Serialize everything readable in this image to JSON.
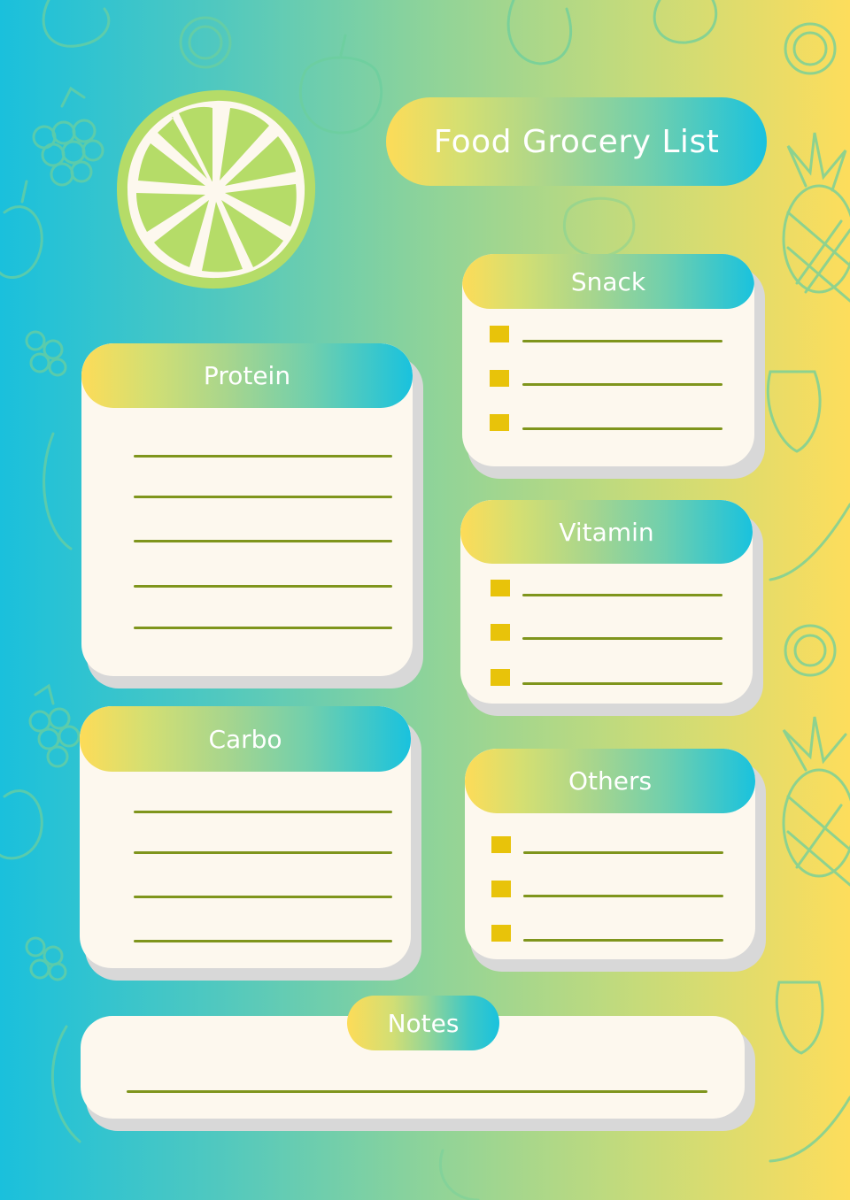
{
  "page": {
    "title": "Food Grocery List",
    "colors": {
      "gradient_start": "#1ac0dc",
      "gradient_end": "#fddd5c",
      "card_bg": "#fdf8ee",
      "card_shadow": "#d8d8d8",
      "line": "#7f951c",
      "checkbox": "#e8c30a",
      "header_text": "#ffffff",
      "lime_flesh": "#b5dc68",
      "lime_pith": "#fdf8ee",
      "doodle": "#6ccf9e"
    }
  },
  "decorations": {
    "lime_icon": "lime-slice",
    "background_doodles": [
      "pear",
      "lemon-slice",
      "grapes",
      "apple",
      "pineapple",
      "strawberry",
      "banana",
      "watermelon",
      "blueberries"
    ]
  },
  "sections": {
    "protein": {
      "label": "Protein",
      "line_count": 5
    },
    "carbo": {
      "label": "Carbo",
      "line_count": 4
    },
    "snack": {
      "label": "Snack",
      "item_count": 3
    },
    "vitamin": {
      "label": "Vitamin",
      "item_count": 3
    },
    "others": {
      "label": "Others",
      "item_count": 3
    },
    "notes": {
      "label": "Notes",
      "line_count": 1
    }
  }
}
